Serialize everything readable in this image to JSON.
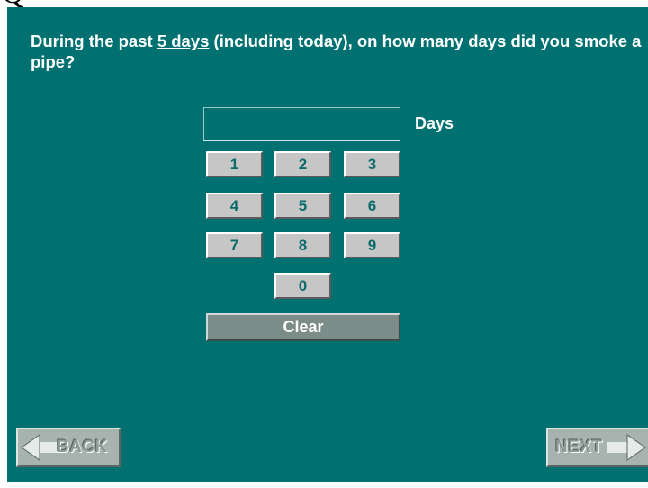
{
  "question": {
    "text_before": "During the past ",
    "emphasis": "5 days",
    "text_after": " (including today), on how many days did you smoke a pipe?"
  },
  "answer": {
    "value": "",
    "unit_label": "Days"
  },
  "keypad": {
    "keys": [
      "1",
      "2",
      "3",
      "4",
      "5",
      "6",
      "7",
      "8",
      "9",
      "0"
    ],
    "clear_label": "Clear"
  },
  "nav": {
    "back_label": "BACK",
    "next_label": "NEXT"
  },
  "colors": {
    "background": "#007070",
    "key_face": "#c6c6c6",
    "key_text": "#0a6a6a",
    "clear_face": "#7c8c88"
  },
  "icons": [
    "arrow-left-icon",
    "arrow-right-icon"
  ]
}
